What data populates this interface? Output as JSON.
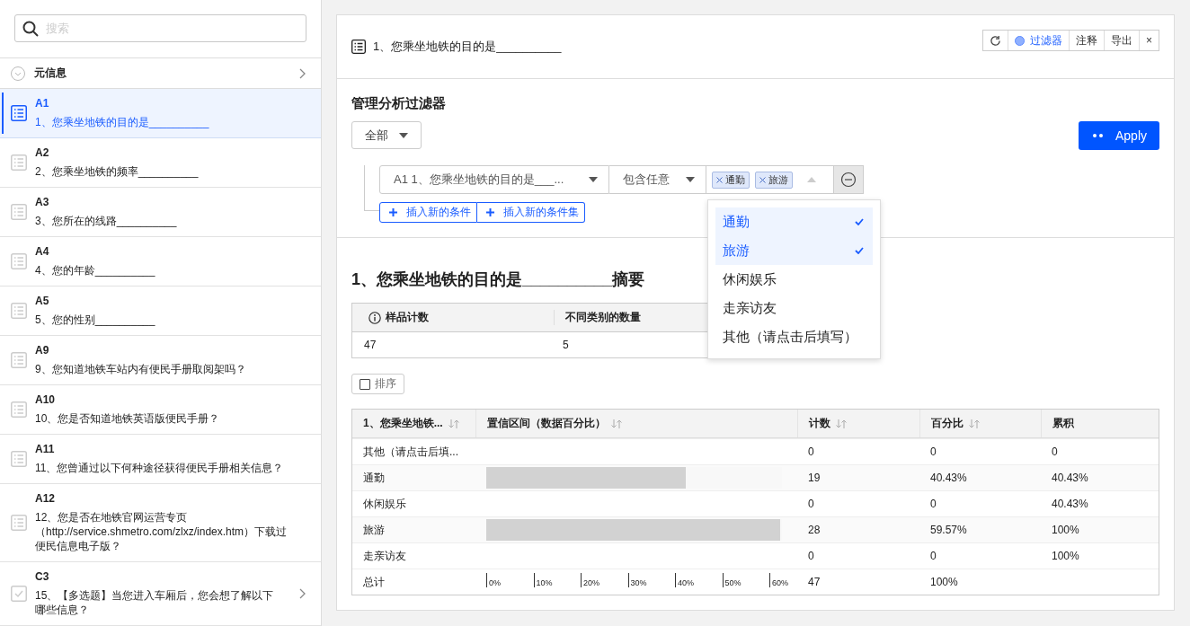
{
  "sidebar": {
    "search": {
      "placeholder": "搜索"
    },
    "meta": {
      "label": "元信息"
    },
    "items": [
      {
        "code": "A1",
        "title": "1、您乘坐地铁的目的是__________",
        "kind": "list",
        "selected": true,
        "expandable": false
      },
      {
        "code": "A2",
        "title": "2、您乘坐地铁的频率__________",
        "kind": "list",
        "selected": false,
        "expandable": false
      },
      {
        "code": "A3",
        "title": "3、您所在的线路__________",
        "kind": "list",
        "selected": false,
        "expandable": false
      },
      {
        "code": "A4",
        "title": "4、您的年龄__________",
        "kind": "list",
        "selected": false,
        "expandable": false
      },
      {
        "code": "A5",
        "title": "5、您的性别__________",
        "kind": "list",
        "selected": false,
        "expandable": false
      },
      {
        "code": "A9",
        "title": "9、您知道地铁车站内有便民手册取阅架吗？",
        "kind": "list",
        "selected": false,
        "expandable": false
      },
      {
        "code": "A10",
        "title": "10、您是否知道地铁英语版便民手册？",
        "kind": "list",
        "selected": false,
        "expandable": false
      },
      {
        "code": "A11",
        "title": "11、您曾通过以下何种途径获得便民手册相关信息？",
        "kind": "list",
        "selected": false,
        "expandable": false
      },
      {
        "code": "A12",
        "title": "12、您是否在地铁官网运营专页（http://service.shmetro.com/zlxz/index.htm）下载过便民信息电子版？",
        "kind": "list",
        "selected": false,
        "expandable": false
      },
      {
        "code": "C3",
        "title": "15、【多选题】当您进入车厢后，您会想了解以下哪些信息？",
        "kind": "check",
        "selected": false,
        "expandable": true
      }
    ]
  },
  "panel": {
    "title": "1、您乘坐地铁的目的是__________",
    "toolbar": [
      {
        "kind": "refresh"
      },
      {
        "kind": "filter",
        "label": "过滤器",
        "active": true
      },
      {
        "kind": "text",
        "label": "注释"
      },
      {
        "kind": "text",
        "label": "导出"
      },
      {
        "kind": "close",
        "label": "×"
      }
    ],
    "filter": {
      "heading": "管理分析过滤器",
      "scope": "全部",
      "apply": "Apply",
      "condition": {
        "field": "A1 1、您乘坐地铁的目的是___...",
        "operator": "包含任意",
        "tags": [
          "通勤",
          "旅游"
        ]
      },
      "insert_buttons": [
        "插入新的条件",
        "插入新的条件集"
      ],
      "options": [
        {
          "label": "通勤",
          "selected": true
        },
        {
          "label": "旅游",
          "selected": true
        },
        {
          "label": "休闲娱乐",
          "selected": false
        },
        {
          "label": "走亲访友",
          "selected": false
        },
        {
          "label": "其他（请点击后填写）",
          "selected": false
        }
      ]
    },
    "summary": {
      "title": "1、您乘坐地铁的目的是__________摘要",
      "stats": {
        "columns": [
          "样品计数",
          "不同类别的数量"
        ],
        "values": [
          "47",
          "5"
        ]
      },
      "sort": {
        "label": "排序",
        "checked": false
      },
      "table": {
        "columns": [
          {
            "label": "1、您乘坐地铁...",
            "sortable": true
          },
          {
            "label": "置信区间（数据百分比）",
            "sortable": true
          },
          {
            "label": "计数",
            "sortable": true
          },
          {
            "label": "百分比",
            "sortable": true
          },
          {
            "label": "累积",
            "sortable": false
          }
        ],
        "rows": [
          {
            "label": "其他（请点击后填...",
            "count": "0",
            "percent": "0",
            "cumulative": "0"
          },
          {
            "label": "通勤",
            "level": 0.674,
            "count": "19",
            "percent": "40.43%",
            "cumulative": "40.43%"
          },
          {
            "label": "休闲娱乐",
            "count": "0",
            "percent": "0",
            "cumulative": "40.43%"
          },
          {
            "label": "旅游",
            "level": 0.993,
            "count": "28",
            "percent": "59.57%",
            "cumulative": "100%"
          },
          {
            "label": "走亲访友",
            "count": "0",
            "percent": "0",
            "cumulative": "100%"
          }
        ],
        "total": {
          "label": "总计",
          "ticks": [
            "0%",
            "10%",
            "20%",
            "30%",
            "40%",
            "50%",
            "60%"
          ],
          "count": "47",
          "percent": "100%"
        }
      }
    }
  }
}
